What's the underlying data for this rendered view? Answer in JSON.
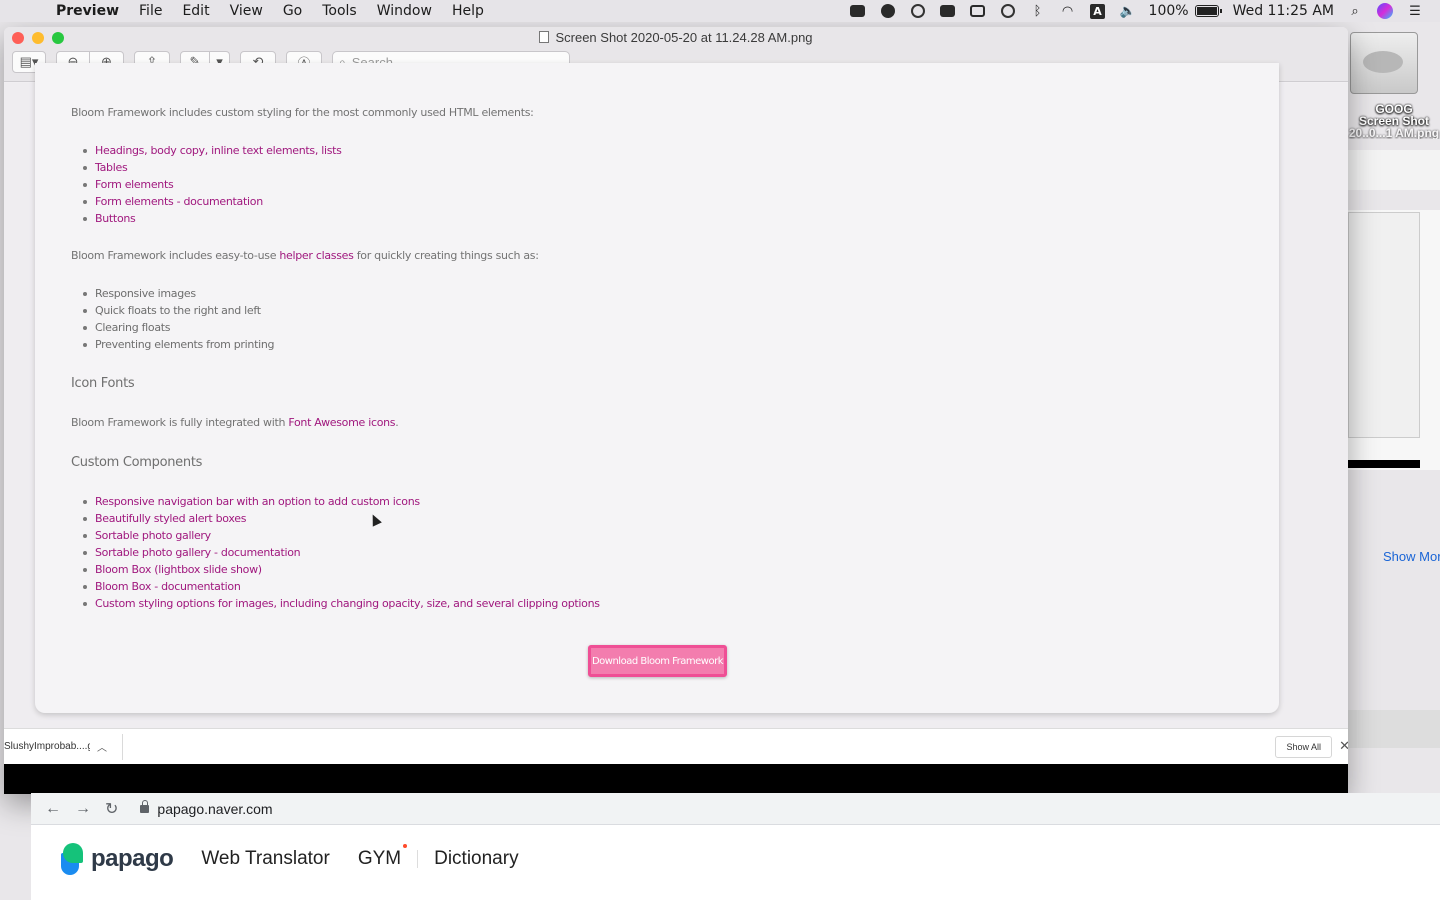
{
  "menubar": {
    "app_name": "Preview",
    "menus": [
      "File",
      "Edit",
      "View",
      "Go",
      "Tools",
      "Window",
      "Help"
    ],
    "battery": "100%",
    "battery_level": 1.0,
    "clock": "Wed 11:25 AM"
  },
  "desktop": {
    "icon_label_1": "GOOG",
    "icon_label_2": "Screen Shot",
    "icon_label_3": "20..0...1 AM.png",
    "show_more": "Show Mor"
  },
  "window": {
    "title": "Screen Shot 2020-05-20 at 11.24.28 AM.png",
    "search_placeholder": "Search"
  },
  "page": {
    "intro": "Bloom Framework includes custom styling for the most commonly used HTML elements:",
    "element_links": [
      "Headings, body copy, inline text elements, lists",
      "Tables",
      "Form elements",
      "Form elements - documentation",
      "Buttons"
    ],
    "helpers_before": "Bloom Framework includes easy-to-use ",
    "helpers_link": "helper classes",
    "helpers_after": " for quickly creating things such as:",
    "helper_items": [
      "Responsive images",
      "Quick floats to the right and left",
      "Clearing floats",
      "Preventing elements from printing"
    ],
    "icon_fonts_heading": "Icon Fonts",
    "icon_fonts_before": "Bloom Framework is fully integrated with ",
    "icon_fonts_link": "Font Awesome icons",
    "icon_fonts_after": ".",
    "custom_heading": "Custom Components",
    "component_links": [
      "Responsive navigation bar with an option to add custom icons",
      "Beautifully styled alert boxes",
      "Sortable photo gallery",
      "Sortable photo gallery - documentation",
      "Bloom Box (lightbox slide show)",
      "Bloom Box - documentation",
      "Custom styling options for images, including changing opacity, size, and several clipping options"
    ],
    "download_button": "Download Bloom Framework"
  },
  "shelf": {
    "file_name": "SlushyImprobab....gif",
    "show_all": "Show All"
  },
  "browser": {
    "url": "papago.naver.com",
    "brand": "papago",
    "nav": [
      "Web Translator",
      "GYM",
      "Dictionary"
    ]
  }
}
